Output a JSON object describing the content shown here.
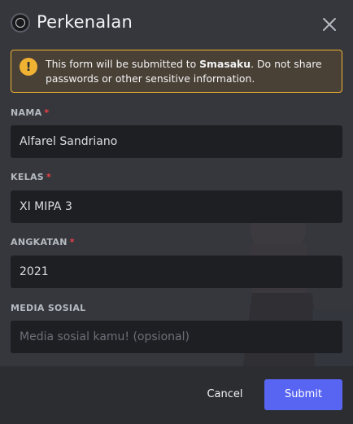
{
  "modal": {
    "title": "Perkenalan",
    "server_icon": "server-avatar-icon",
    "close_icon": "close-icon"
  },
  "warning": {
    "icon": "warning-icon",
    "icon_glyph": "!",
    "prefix": "This form will be submitted to ",
    "server_name": "Smasaku",
    "suffix": ". Do not share passwords or other sensitive information.",
    "border_color": "#f0b232"
  },
  "fields": [
    {
      "label": "NAMA",
      "required": true,
      "value": "Alfarel Sandriano",
      "placeholder": ""
    },
    {
      "label": "KELAS",
      "required": true,
      "value": "XI MIPA 3",
      "placeholder": ""
    },
    {
      "label": "ANGKATAN",
      "required": true,
      "value": "2021",
      "placeholder": ""
    },
    {
      "label": "MEDIA SOSIAL",
      "required": false,
      "value": "",
      "placeholder": "Media sosial kamu! (opsional)"
    }
  ],
  "required_marker": "*",
  "footer": {
    "cancel_label": "Cancel",
    "submit_label": "Submit",
    "submit_color": "#5865f2"
  }
}
